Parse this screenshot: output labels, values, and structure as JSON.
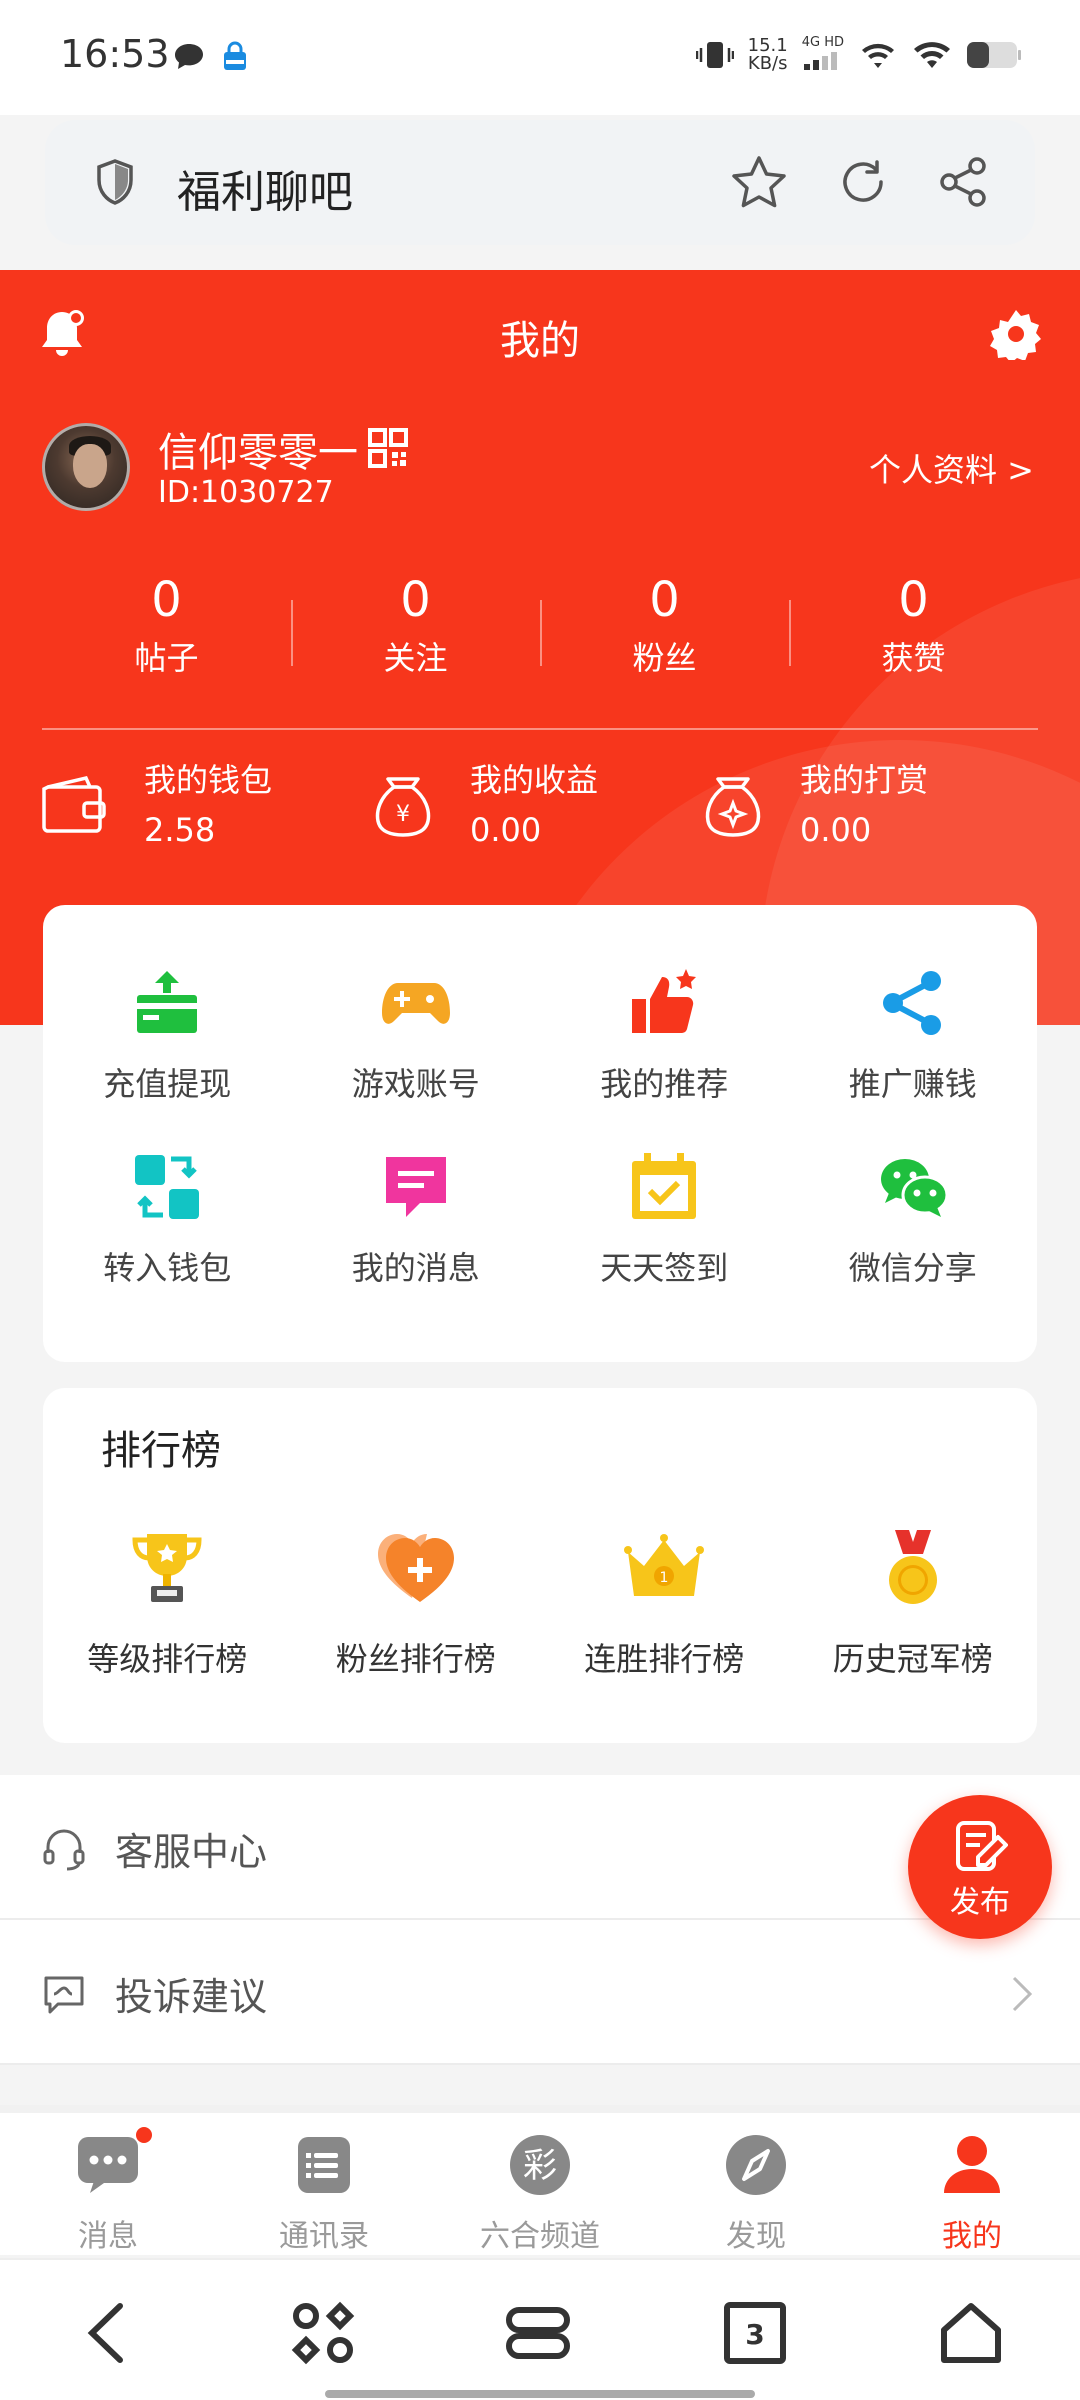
{
  "status_bar": {
    "time": "16:53",
    "net_speed": "15.1",
    "net_speed_unit": "KB/s",
    "network_label": "4G HD"
  },
  "browser": {
    "title": "福利聊吧"
  },
  "header": {
    "title": "我的",
    "user_name": "信仰零零一",
    "user_id": "ID:1030727",
    "profile_link": "个人资料 >"
  },
  "stats": [
    {
      "value": "0",
      "label": "帖子"
    },
    {
      "value": "0",
      "label": "关注"
    },
    {
      "value": "0",
      "label": "粉丝"
    },
    {
      "value": "0",
      "label": "获赞"
    }
  ],
  "wallet": [
    {
      "title": "我的钱包",
      "value": "2.58"
    },
    {
      "title": "我的收益",
      "value": "0.00"
    },
    {
      "title": "我的打赏",
      "value": "0.00"
    }
  ],
  "menu": [
    {
      "label": "充值提现"
    },
    {
      "label": "游戏账号"
    },
    {
      "label": "我的推荐"
    },
    {
      "label": "推广赚钱"
    },
    {
      "label": "转入钱包"
    },
    {
      "label": "我的消息"
    },
    {
      "label": "天天签到"
    },
    {
      "label": "微信分享"
    }
  ],
  "ranking": {
    "title": "排行榜",
    "items": [
      {
        "label": "等级排行榜"
      },
      {
        "label": "粉丝排行榜"
      },
      {
        "label": "连胜排行榜"
      },
      {
        "label": "历史冠军榜"
      }
    ]
  },
  "list": [
    {
      "label": "客服中心"
    },
    {
      "label": "投诉建议"
    }
  ],
  "fab": {
    "label": "发布"
  },
  "tabs": [
    {
      "label": "消息"
    },
    {
      "label": "通讯录"
    },
    {
      "label": "六合频道"
    },
    {
      "label": "发现"
    },
    {
      "label": "我的"
    }
  ],
  "colors": {
    "brand": "#f7361c",
    "green": "#1fbf3e",
    "orange": "#f5a623",
    "blue": "#1a9ce6",
    "teal": "#12c4c4",
    "pink": "#f0359e",
    "yellow": "#f7c51a"
  }
}
